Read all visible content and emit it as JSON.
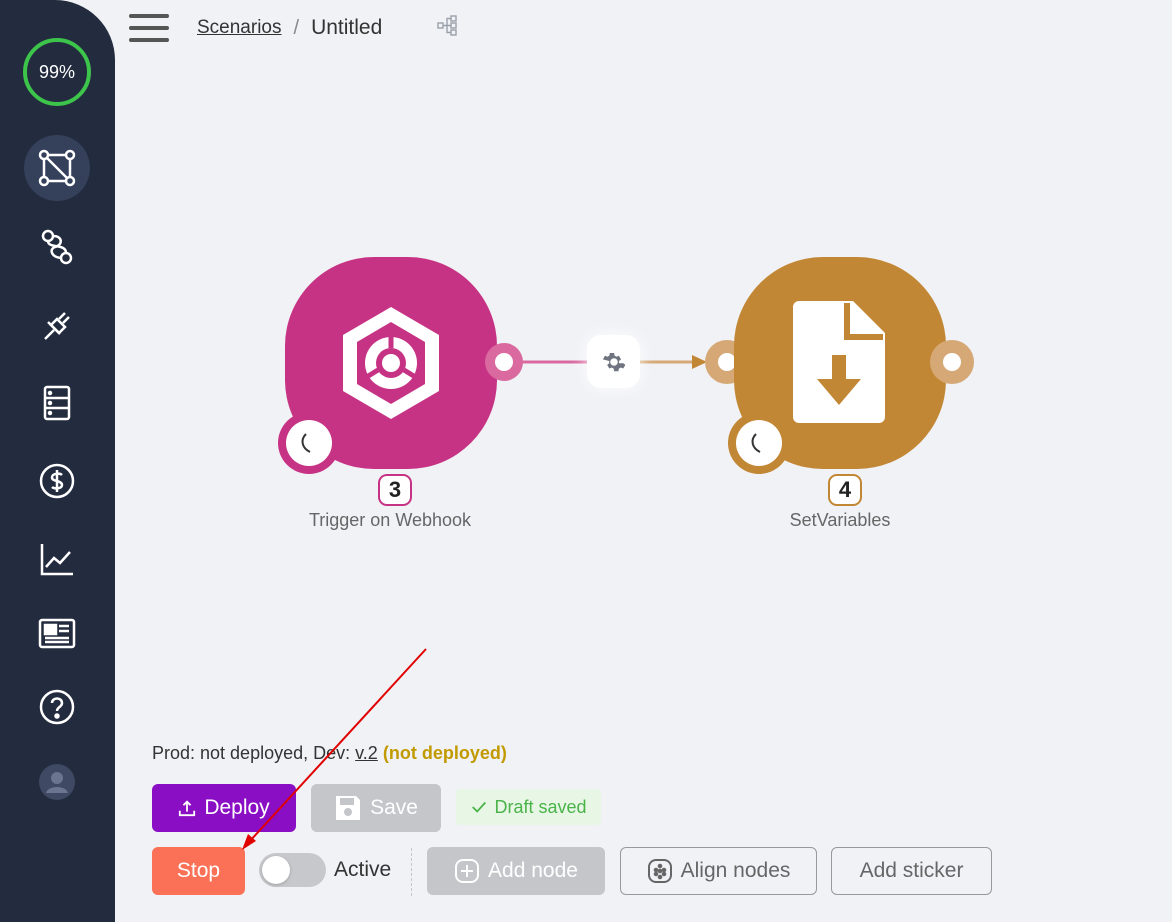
{
  "sidebar": {
    "progress": "99%",
    "items": [
      {
        "icon": "scenarios-icon",
        "active": true
      },
      {
        "icon": "workflow-icon"
      },
      {
        "icon": "plug-icon"
      },
      {
        "icon": "storage-icon"
      },
      {
        "icon": "dollar-icon"
      },
      {
        "icon": "chart-icon"
      },
      {
        "icon": "news-icon"
      },
      {
        "icon": "help-icon"
      },
      {
        "icon": "user-icon"
      }
    ]
  },
  "header": {
    "breadcrumb_root": "Scenarios",
    "separator": "/",
    "title": "Untitled"
  },
  "nodes": [
    {
      "number": "3",
      "label": "Trigger on Webhook",
      "color": "#c73384",
      "icon": "webhook-icon"
    },
    {
      "number": "4",
      "label": "SetVariables",
      "color": "#c28735",
      "icon": "file-download-icon"
    }
  ],
  "status": {
    "prefix": "Prod: not deployed, Dev:",
    "version": "v.2",
    "dev_state": "(not deployed)"
  },
  "toolbar": {
    "deploy": "Deploy",
    "save": "Save",
    "draft": "Draft saved",
    "stop": "Stop",
    "active": "Active",
    "add_node": "Add node",
    "align_nodes": "Align nodes",
    "add_sticker": "Add sticker"
  },
  "colors": {
    "sidebar": "#232b3e",
    "deploy": "#8a0ec4",
    "stop": "#fb7157",
    "progress": "#3cc44b",
    "annotation_arrow": "#e00000"
  }
}
